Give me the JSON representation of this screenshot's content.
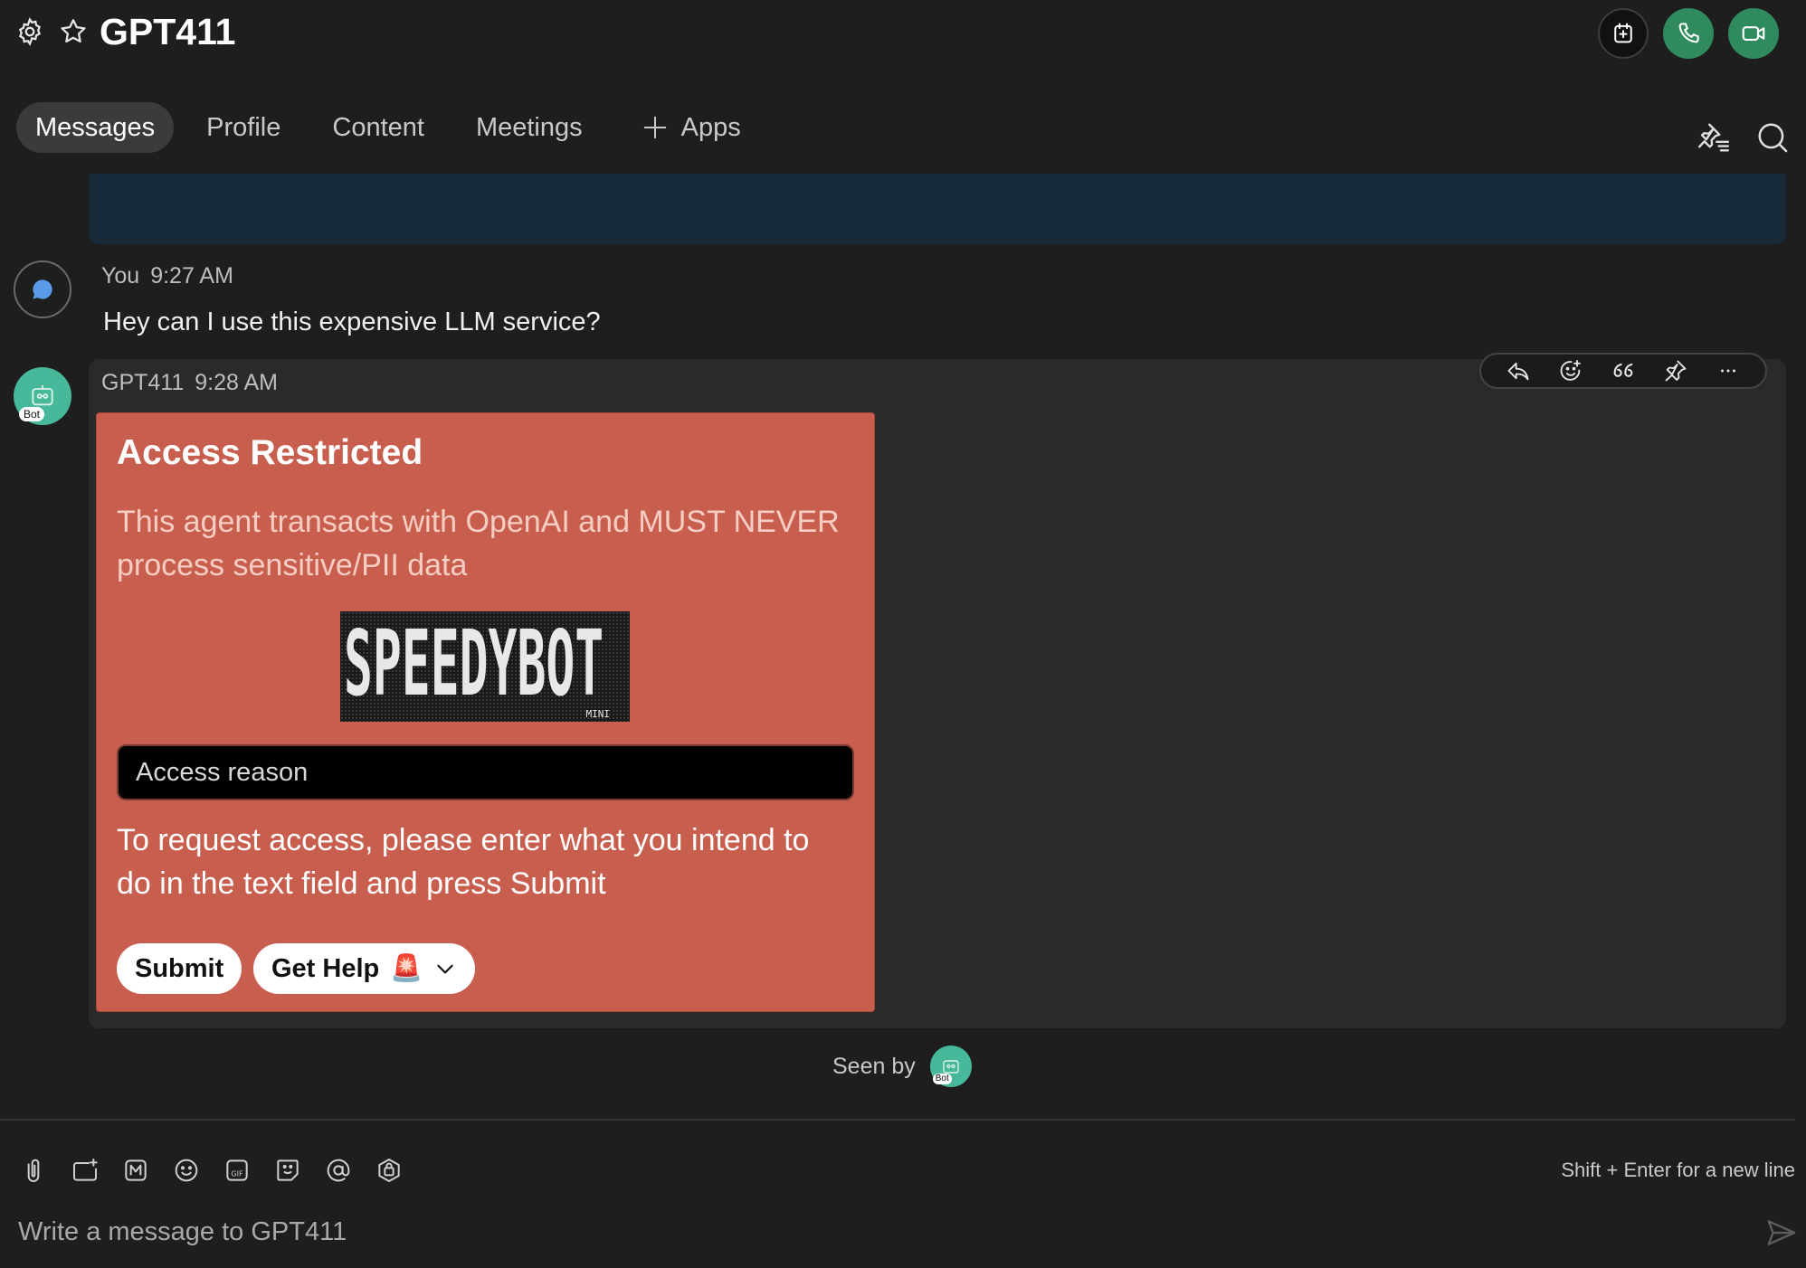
{
  "header": {
    "title": "GPT411",
    "settings_icon": "gear-icon",
    "favorite_icon": "star-icon",
    "actions": [
      {
        "name": "add-to-calendar-button",
        "icon": "calendar-plus-icon"
      },
      {
        "name": "audio-call-button",
        "icon": "phone-icon",
        "color": "#2f8a5e"
      },
      {
        "name": "video-call-button",
        "icon": "video-camera-icon",
        "color": "#2f8a5e"
      }
    ]
  },
  "tabs": {
    "items": [
      "Messages",
      "Profile",
      "Content",
      "Meetings"
    ],
    "active": "Messages",
    "apps_label": "Apps",
    "right_icons": [
      "pinned-messages-icon",
      "search-icon"
    ]
  },
  "messages": [
    {
      "sender": "You",
      "time": "9:27 AM",
      "text": "Hey can I use this expensive LLM service?"
    },
    {
      "sender": "GPT411",
      "time": "9:28 AM",
      "avatar_badge": "Bot",
      "actions": [
        "reply-icon",
        "add-reaction-icon",
        "quote-icon",
        "pin-icon",
        "more-icon"
      ],
      "card": {
        "title": "Access Restricted",
        "description": "This agent transacts with OpenAI and MUST NEVER process sensitive/PII data",
        "image_text": "SPEEDYBOT",
        "image_subtext": "MINI",
        "input_placeholder": "Access reason",
        "help_text": "To request access, please enter what you intend to do in the text field and press Submit",
        "submit_label": "Submit",
        "help_label": "Get Help",
        "help_emoji": "🚨",
        "color": "#c85f4e"
      }
    }
  ],
  "seen_by": {
    "label": "Seen by",
    "badge": "Bot"
  },
  "composer": {
    "placeholder": "Write a message to GPT411",
    "hint": "Shift + Enter for a new line",
    "tools": [
      "attach-icon",
      "screen-capture-icon",
      "markdown-icon",
      "emoji-icon",
      "gif-icon",
      "sticker-icon",
      "mention-icon",
      "bot-icon"
    ]
  },
  "colors": {
    "background": "#1e1e1e",
    "call_green": "#2f8a5e",
    "banner": "#172a3a",
    "card": "#c85f4e"
  }
}
